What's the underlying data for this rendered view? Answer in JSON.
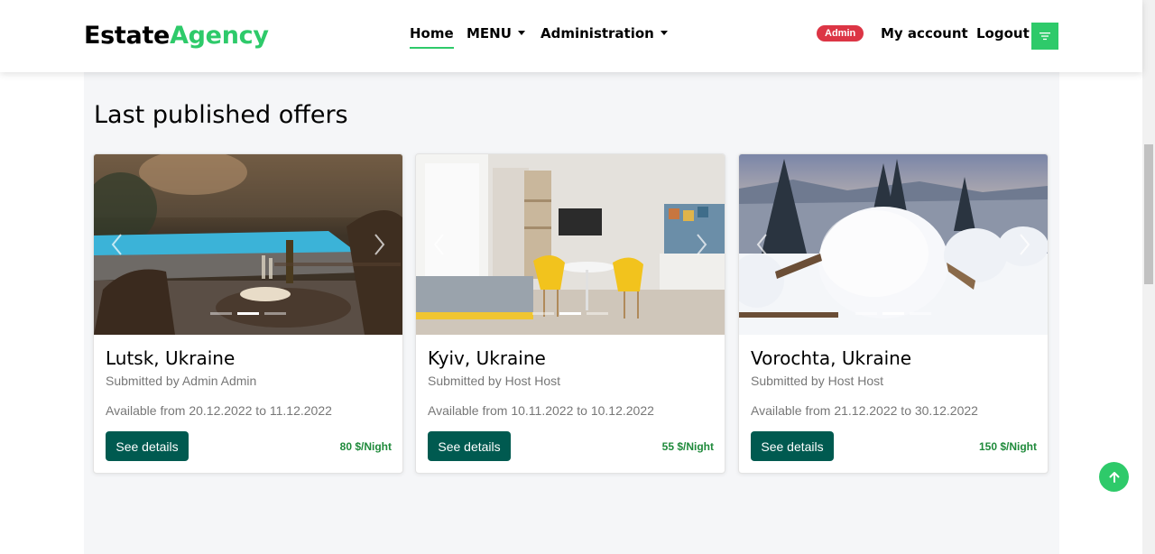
{
  "brand": {
    "part1": "Estate",
    "part2": "Agency"
  },
  "nav": {
    "home": "Home",
    "menu": "MENU",
    "administration": "Administration",
    "badge": "Admin",
    "my_account": "My account",
    "logout": "Logout"
  },
  "section_title": "Last published offers",
  "offers": [
    {
      "city": "Lutsk, Ukraine",
      "submitted": "Submitted by Admin Admin",
      "available": "Available from 20.12.2022 to 11.12.2022",
      "button": "See details",
      "price": "80 $/Night"
    },
    {
      "city": "Kyiv, Ukraine",
      "submitted": "Submitted by Host Host",
      "available": "Available from 10.11.2022 to 10.12.2022",
      "button": "See details",
      "price": "55 $/Night"
    },
    {
      "city": "Vorochta, Ukraine",
      "submitted": "Submitted by Host Host",
      "available": "Available from 21.12.2022 to 30.12.2022",
      "button": "See details",
      "price": "150 $/Night"
    }
  ],
  "colors": {
    "accent": "#2eca6a",
    "button": "#005a50",
    "price": "#1f8a3b",
    "badge": "#dc3545"
  },
  "icons": [
    "filter-icon",
    "chevron-left-icon",
    "chevron-right-icon",
    "arrow-up-icon"
  ]
}
